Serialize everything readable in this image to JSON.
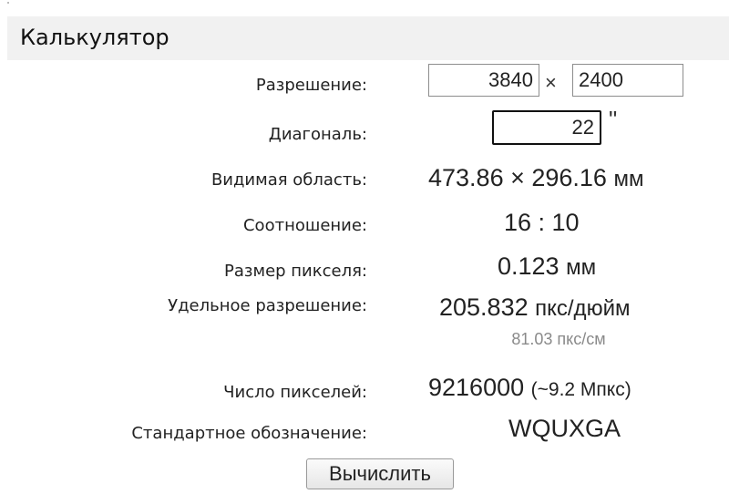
{
  "header": {
    "title": "Калькулятор"
  },
  "form": {
    "resolution": {
      "label": "Разрешение:",
      "width": "3840",
      "times": "×",
      "height": "2400"
    },
    "diagonal": {
      "label": "Диагональ:",
      "value": "22",
      "unit": "\""
    },
    "visible_area": {
      "label": "Видимая область:",
      "value": "473.86 × 296.16",
      "unit": "мм"
    },
    "aspect_ratio": {
      "label": "Соотношение:",
      "value": "16 : 10"
    },
    "pixel_size": {
      "label": "Размер пикселя:",
      "value": "0.123",
      "unit": "мм"
    },
    "pixel_density": {
      "label": "Удельное разрешение:",
      "value": "205.832",
      "unit": "пкс/дюйм",
      "sub_value": "81.03 пкс/см"
    },
    "pixel_count": {
      "label": "Число пикселей:",
      "value": "9216000",
      "suffix": "(~9.2 Мпкс)"
    },
    "standard": {
      "label": "Стандартное обозначение:",
      "value": "WQUXGA"
    },
    "calculate_button": "Вычислить"
  }
}
